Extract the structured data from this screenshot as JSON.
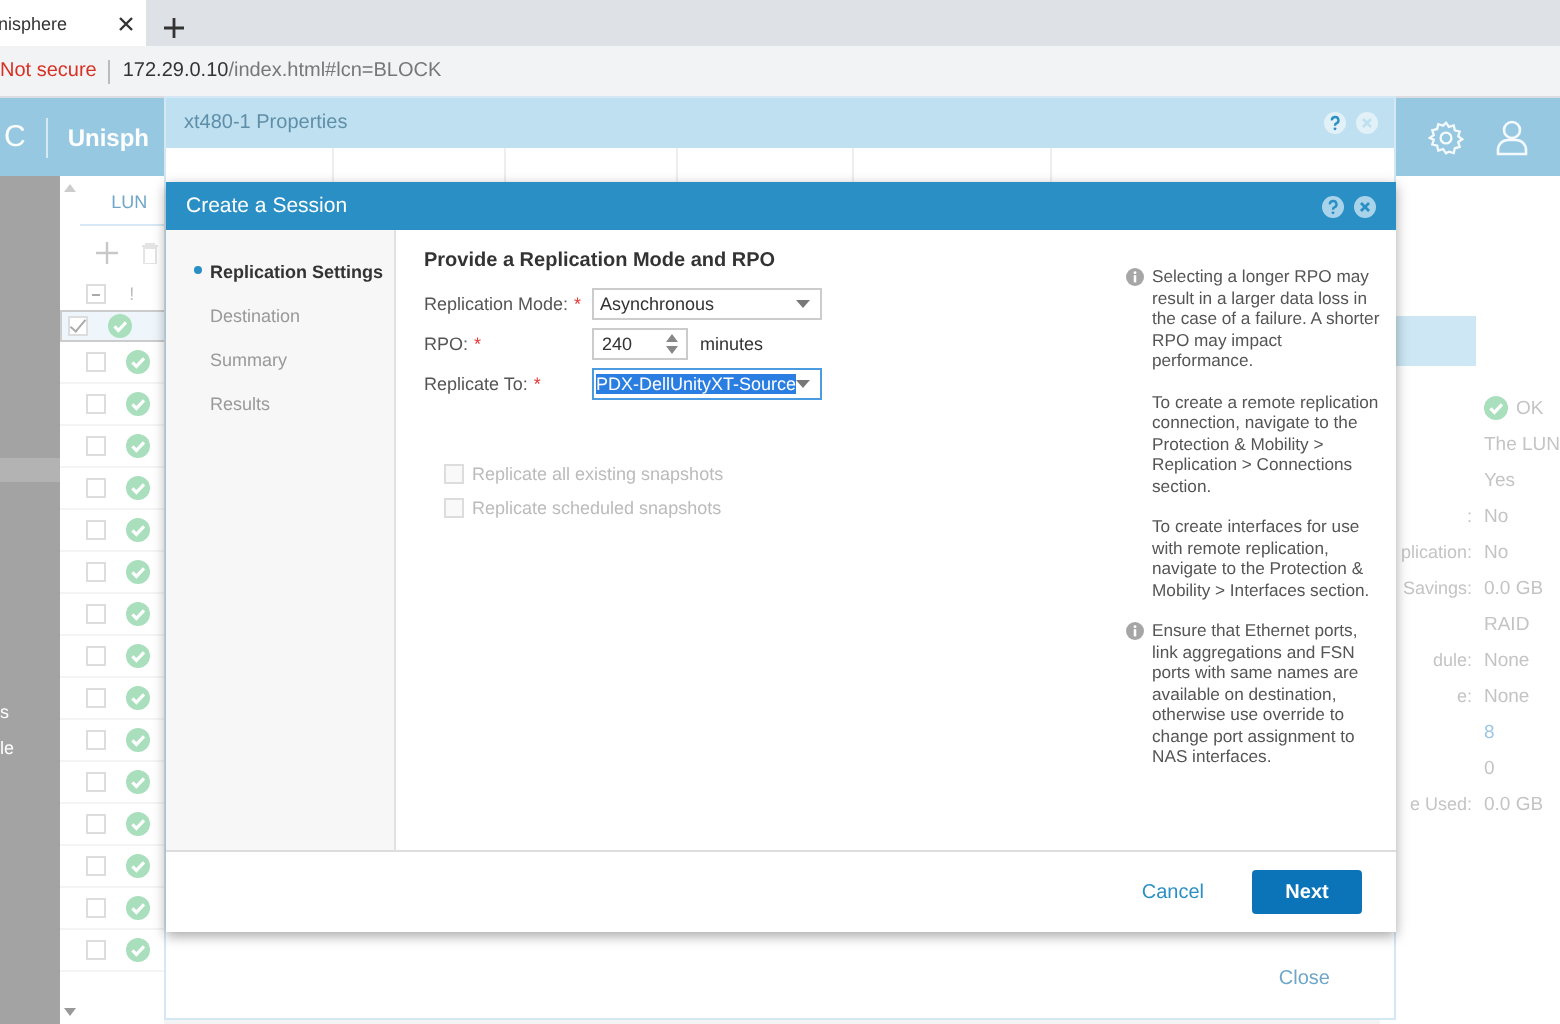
{
  "browser": {
    "tab_title": "nisphere",
    "address": {
      "security": "Not secure",
      "host": "172.29.0.10",
      "path": "/index.html#lcn=BLOCK"
    }
  },
  "app_header": {
    "logo": "C",
    "title": "Unisph"
  },
  "nav": {
    "items": [
      "s",
      "le"
    ]
  },
  "lun_list": {
    "tab": "LUN",
    "select_all_indeterminate": true,
    "header_mark": "!",
    "rows": [
      {
        "selected": true
      },
      {
        "selected": false
      },
      {
        "selected": false
      },
      {
        "selected": false
      },
      {
        "selected": false
      },
      {
        "selected": false
      },
      {
        "selected": false
      },
      {
        "selected": false
      },
      {
        "selected": false
      },
      {
        "selected": false
      },
      {
        "selected": false
      },
      {
        "selected": false
      },
      {
        "selected": false
      },
      {
        "selected": false
      },
      {
        "selected": false
      },
      {
        "selected": false
      }
    ]
  },
  "properties": {
    "title": "xt480-1 Properties",
    "close": "Close",
    "details": [
      {
        "kind": "status",
        "value": "OK"
      },
      {
        "kind": "text",
        "value": "The LUN"
      },
      {
        "kind": "text",
        "value": "Yes"
      },
      {
        "kind": "text",
        "label": ":",
        "value": "No"
      },
      {
        "kind": "text",
        "label": "plication:",
        "value": "No"
      },
      {
        "kind": "text",
        "label": "Savings:",
        "value": "0.0 GB"
      },
      {
        "kind": "text",
        "value": "RAID"
      },
      {
        "kind": "text",
        "label": "dule:",
        "value": "None"
      },
      {
        "kind": "text",
        "label": "e:",
        "value": "None"
      },
      {
        "kind": "link",
        "value": "8"
      },
      {
        "kind": "text",
        "value": "0"
      },
      {
        "kind": "text",
        "label": "e Used:",
        "value": "0.0 GB"
      }
    ]
  },
  "session": {
    "title": "Create a Session",
    "steps": [
      {
        "label": "Replication Settings",
        "selected": true
      },
      {
        "label": "Destination",
        "selected": false
      },
      {
        "label": "Summary",
        "selected": false
      },
      {
        "label": "Results",
        "selected": false
      }
    ],
    "heading": "Provide a Replication Mode and RPO",
    "fields": [
      {
        "kind": "select",
        "label": "Replication Mode:",
        "required_mark": "*",
        "value": "Asynchronous",
        "text_selected": false
      },
      {
        "kind": "spinner",
        "label": "RPO:",
        "required_mark": "*",
        "value": "240",
        "unit": "minutes"
      },
      {
        "kind": "select",
        "label": "Replicate To:",
        "required_mark": "*",
        "value": "PDX-DellUnityXT-Source",
        "text_selected": true
      }
    ],
    "checkboxes": [
      {
        "label": "Replicate all existing snapshots",
        "checked": false,
        "disabled": true
      },
      {
        "label": "Replicate scheduled snapshots",
        "checked": false,
        "disabled": true
      }
    ],
    "notes": [
      {
        "paragraphs": [
          "Selecting a longer RPO may result in a larger data loss in the case of a failure. A shorter RPO may impact performance.",
          "To create a remote replication connection, navigate to the Protection & Mobility > Replication > Connections section.",
          "To create interfaces for use with remote replication, navigate to the Protection & Mobility > Interfaces section."
        ]
      },
      {
        "paragraphs": [
          "Ensure that Ethernet ports, link aggregations and FSN ports with same names are available on destination, otherwise use override to change port assignment to NAS interfaces."
        ]
      }
    ],
    "cancel": "Cancel",
    "next": "Next"
  }
}
